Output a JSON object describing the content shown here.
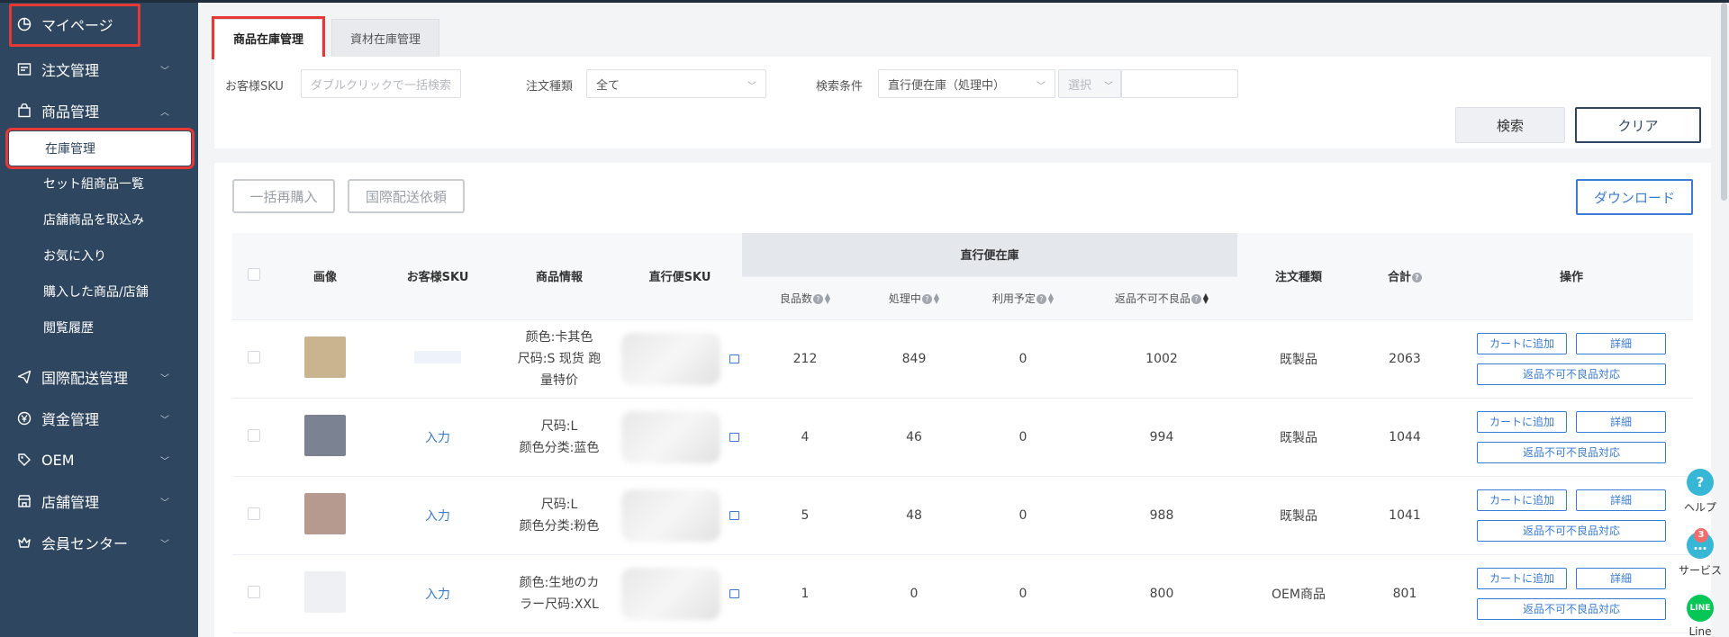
{
  "sidebar": {
    "mypage": "マイページ",
    "items": [
      {
        "label": "注文管理",
        "icon": "order-icon"
      },
      {
        "label": "商品管理",
        "icon": "bag-icon"
      },
      {
        "label": "国際配送管理",
        "icon": "send-icon"
      },
      {
        "label": "資金管理",
        "icon": "yen-icon"
      },
      {
        "label": "OEM",
        "icon": "tag-icon"
      },
      {
        "label": "店舗管理",
        "icon": "store-icon"
      },
      {
        "label": "会員センター",
        "icon": "crown-icon"
      }
    ],
    "subitems": [
      "在庫管理",
      "セット組商品一覧",
      "店舗商品を取込み",
      "お気に入り",
      "購入した商品/店舗",
      "閲覧履歴"
    ]
  },
  "tabs": [
    "商品在庫管理",
    "資材在庫管理"
  ],
  "filters": {
    "sku_label": "お客様SKU",
    "sku_placeholder": "ダブルクリックで一括検索",
    "type_label": "注文種類",
    "type_value": "全て",
    "cond_label": "検索条件",
    "cond_value": "直行便在庫（処理中）",
    "select_placeholder": "選択"
  },
  "buttons": {
    "search": "検索",
    "clear": "クリア",
    "bulk": "一括再購入",
    "intl": "国際配送依頼",
    "download": "ダウンロード"
  },
  "table": {
    "headers": {
      "image": "画像",
      "sku": "お客様SKU",
      "info": "商品情報",
      "direct_sku": "直行便SKU",
      "zaiko": "直行便在庫",
      "good": "良品数",
      "proc": "処理中",
      "plan": "利用予定",
      "bad": "返品不可不良品",
      "type": "注文種類",
      "total": "合計",
      "ops": "操作"
    },
    "rows": [
      {
        "sku": "",
        "info1": "颜色:卡其色",
        "info2": "尺码:S 现货 跑",
        "info3": "量特价",
        "good": "212",
        "proc": "849",
        "plan": "0",
        "bad": "1002",
        "type": "既製品",
        "total": "2063",
        "thumb": "#c9b48f"
      },
      {
        "sku": "入力",
        "info1": "尺码:L",
        "info2": "颜色分类:蓝色",
        "info3": "",
        "good": "4",
        "proc": "46",
        "plan": "0",
        "bad": "994",
        "type": "既製品",
        "total": "1044",
        "thumb": "#7b8393"
      },
      {
        "sku": "入力",
        "info1": "尺码:L",
        "info2": "颜色分类:粉色",
        "info3": "",
        "good": "5",
        "proc": "48",
        "plan": "0",
        "bad": "988",
        "type": "既製品",
        "total": "1041",
        "thumb": "#b69a8f"
      },
      {
        "sku": "入力",
        "info1": "颜色:生地のカ",
        "info2": "ラー尺码:XXL",
        "info3": "",
        "good": "1",
        "proc": "0",
        "plan": "0",
        "bad": "800",
        "type": "OEM商品",
        "total": "801",
        "thumb": "#eef0f3"
      }
    ],
    "op_cart": "カートに追加",
    "op_detail": "詳細",
    "op_bad": "返品不可不良品対応"
  },
  "float": {
    "help": "ヘルプ",
    "service": "サービス",
    "service_badge": "3",
    "line": "Line",
    "line_icon_text": "LINE"
  }
}
